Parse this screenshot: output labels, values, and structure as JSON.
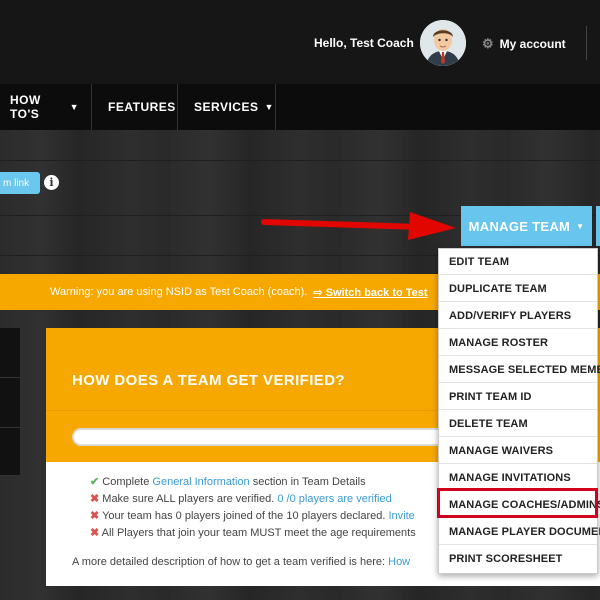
{
  "header": {
    "greeting": "Hello, Test Coach",
    "account_label": "My account"
  },
  "nav": {
    "items": [
      {
        "label": "HOW TO'S",
        "has_caret": true
      },
      {
        "label": "FEATURES",
        "has_caret": false
      },
      {
        "label": "SERVICES",
        "has_caret": true
      }
    ]
  },
  "page": {
    "team_link_label": "m link",
    "manage_button_label": "MANAGE TEAM"
  },
  "warning": {
    "text": "Warning: you are using NSID as Test Coach (coach).",
    "switch_label": "Switch back to Test"
  },
  "card": {
    "title": "HOW DOES A TEAM GET VERIFIED?",
    "checklist": [
      {
        "status": "ok",
        "pre": "Complete ",
        "link": "General Information",
        "post": " section in Team Details"
      },
      {
        "status": "bad",
        "pre": "Make sure ALL players are verified. ",
        "link": "0 /0 players are verified",
        "post": ""
      },
      {
        "status": "bad",
        "pre": "Your team has 0 players joined of the 10 players declared. ",
        "link": "Invite",
        "post": ""
      },
      {
        "status": "bad",
        "pre": "All Players that join your team MUST meet the age requirements",
        "link": "",
        "post": ""
      }
    ],
    "description": "A more detailed description of how to get a team verified is here: ",
    "description_link": "How"
  },
  "dropdown": {
    "items": [
      "EDIT TEAM",
      "DUPLICATE TEAM",
      "ADD/VERIFY PLAYERS",
      "MANAGE ROSTER",
      "MESSAGE SELECTED MEMBERS",
      "PRINT TEAM ID",
      "DELETE TEAM",
      "MANAGE WAIVERS",
      "MANAGE INVITATIONS",
      "MANAGE COACHES/ADMINS",
      "MANAGE PLAYER DOCUMENTS",
      "PRINT SCORESHEET"
    ],
    "highlighted_item": "MANAGE COACHES/ADMINS"
  },
  "colors": {
    "accent_blue": "#67c5ee",
    "warning_orange": "#f7a800",
    "highlight_red": "#d0021b"
  },
  "icons": {
    "avatar": "coach-avatar",
    "account": "gear-icon",
    "info": "info-icon",
    "arrow": "red-arrow-annotation"
  }
}
